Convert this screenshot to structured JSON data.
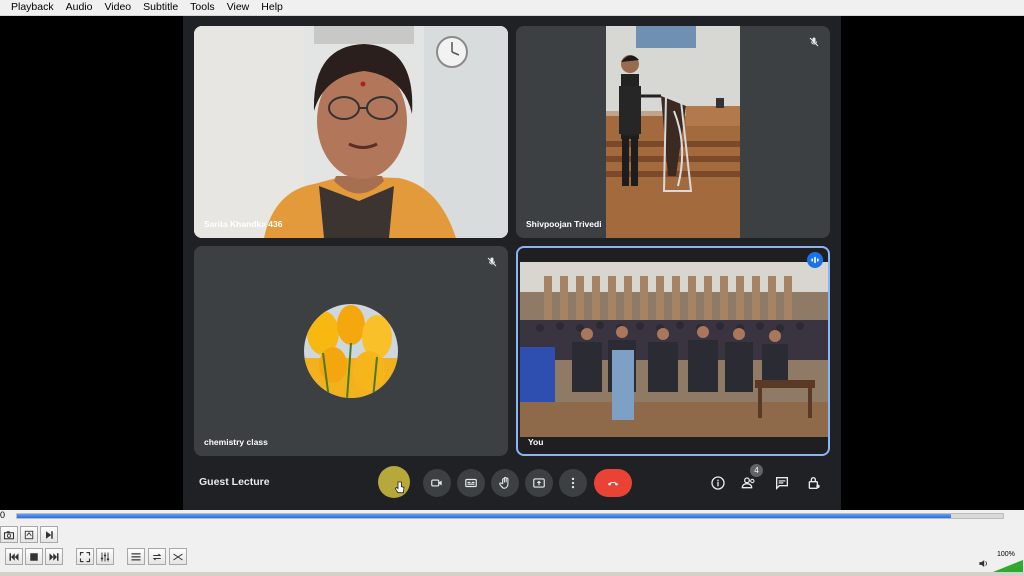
{
  "menu": [
    "Playback",
    "Audio",
    "Video",
    "Subtitle",
    "Tools",
    "View",
    "Help"
  ],
  "tiles": [
    {
      "name": "Sarita Khandka 436"
    },
    {
      "name": "Shivpoojan Trivedi"
    },
    {
      "name": "chemistry class"
    },
    {
      "name": "You"
    }
  ],
  "meeting_title": "Guest Lecture",
  "participants_badge": "4",
  "player": {
    "time_left": "0",
    "progress": 0.947,
    "volume_label": "100%",
    "volume": 1.0
  },
  "colors": {
    "meet_bg": "#202124",
    "tile_bg": "#3c4043",
    "end_call": "#ea4335",
    "speaking_border": "#8ab4f8",
    "seek_fill": "#2a6fd6",
    "volume_fill": "#2eaa2e"
  }
}
